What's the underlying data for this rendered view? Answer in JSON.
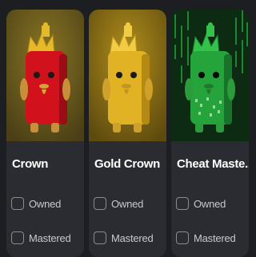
{
  "cards": [
    {
      "name": "Crown",
      "theme": "red",
      "bg": "#6b5a1c",
      "options": [
        {
          "label": "Owned",
          "checked": false
        },
        {
          "label": "Mastered",
          "checked": false
        }
      ]
    },
    {
      "name": "Gold Crown",
      "theme": "gold",
      "bg": "#8a6d12",
      "options": [
        {
          "label": "Owned",
          "checked": false
        },
        {
          "label": "Mastered",
          "checked": false
        }
      ]
    },
    {
      "name": "Cheat Maste...",
      "theme": "matrix",
      "bg": "#0d2a12",
      "options": [
        {
          "label": "Owned",
          "checked": false
        },
        {
          "label": "Mastered",
          "checked": false
        }
      ]
    }
  ],
  "colors": {
    "page_bg": "#1d1e22",
    "card_bg": "#2b2c31",
    "red_body": "#d1121c",
    "gold_body": "#e0b224",
    "green_body": "#24a43a",
    "crown": "#e5ba2a"
  }
}
